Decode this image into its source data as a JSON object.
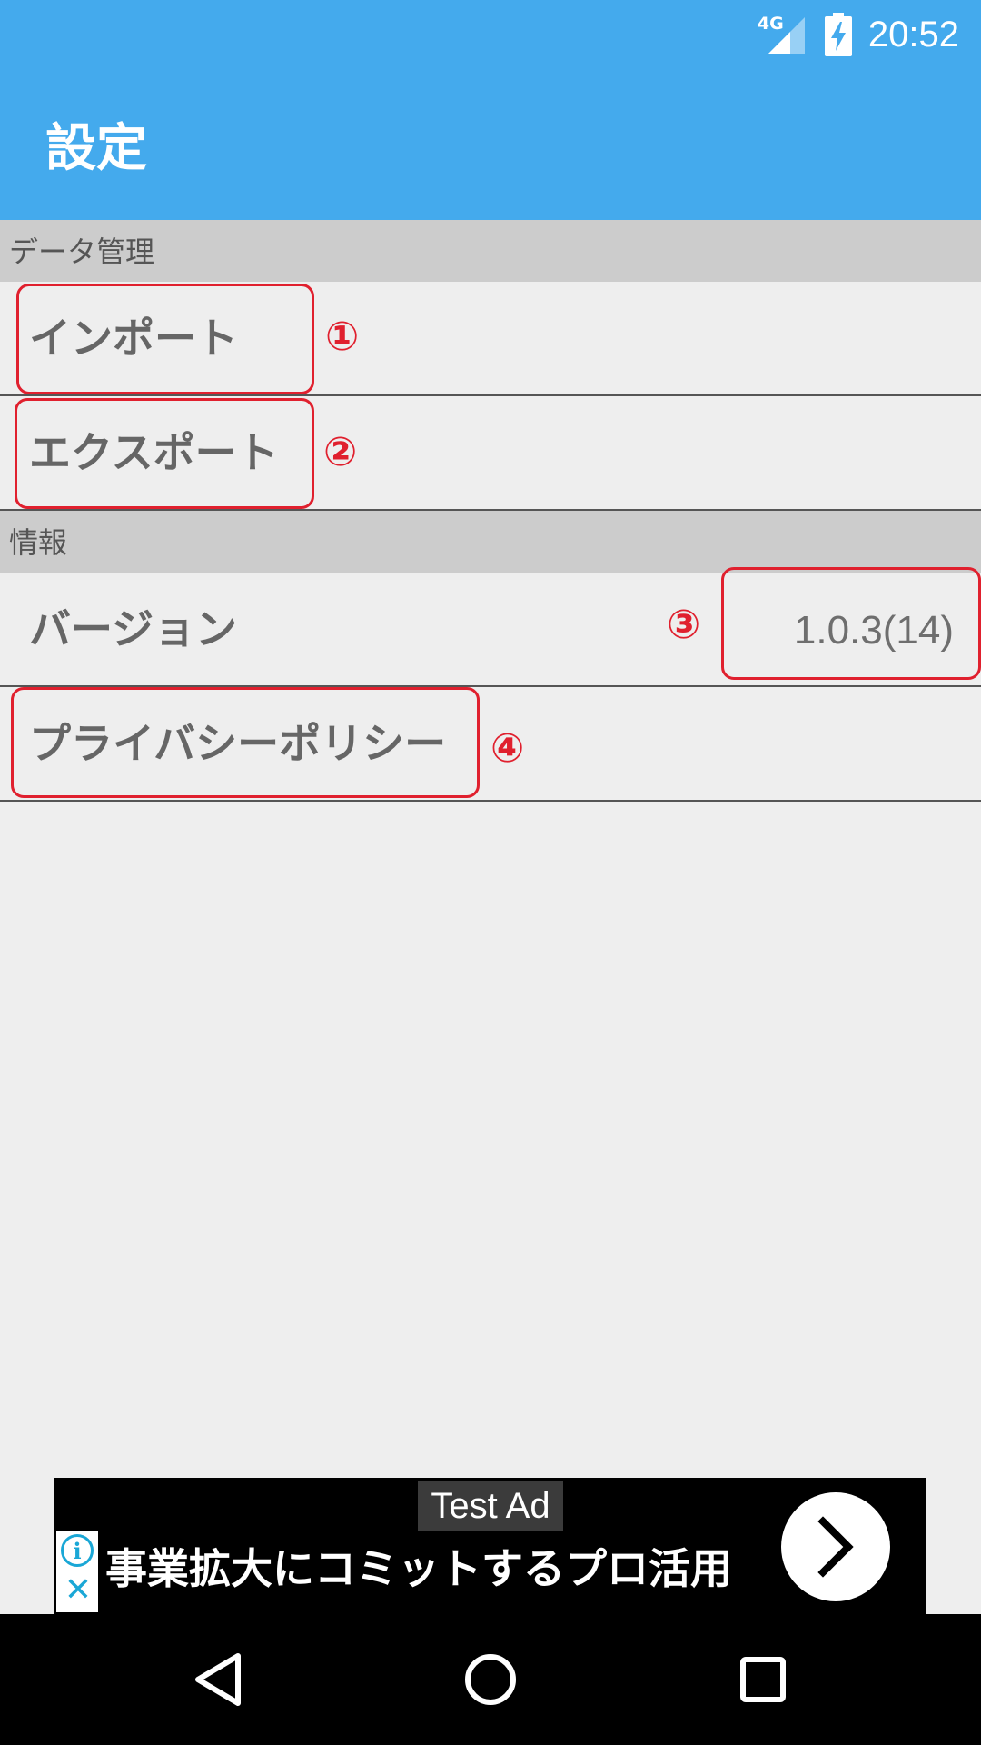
{
  "status_bar": {
    "network": "4G",
    "time": "20:52",
    "signal_icon": "cell-signal-icon",
    "battery_icon": "battery-charging-icon"
  },
  "app_bar": {
    "title": "設定"
  },
  "sections": [
    {
      "header": "データ管理",
      "items": [
        {
          "label": "インポート",
          "marker": "①"
        },
        {
          "label": "エクスポート",
          "marker": "②"
        }
      ]
    },
    {
      "header": "情報",
      "items": [
        {
          "label": "バージョン",
          "value": "1.0.3(14)",
          "marker": "③"
        },
        {
          "label": "プライバシーポリシー",
          "marker": "④"
        }
      ]
    }
  ],
  "ad": {
    "label": "Test Ad",
    "text": "事業拡大にコミットするプロ活用",
    "info_icon": "info-icon",
    "close_icon": "close-icon",
    "arrow_icon": "chevron-right-icon"
  },
  "nav_bar": {
    "back_icon": "back-triangle-icon",
    "home_icon": "home-circle-icon",
    "recents_icon": "recents-square-icon"
  },
  "colors": {
    "primary": "#44aaed",
    "annotation": "#e0202e",
    "section_header_bg": "#cccccc",
    "background": "#eeeeee"
  }
}
